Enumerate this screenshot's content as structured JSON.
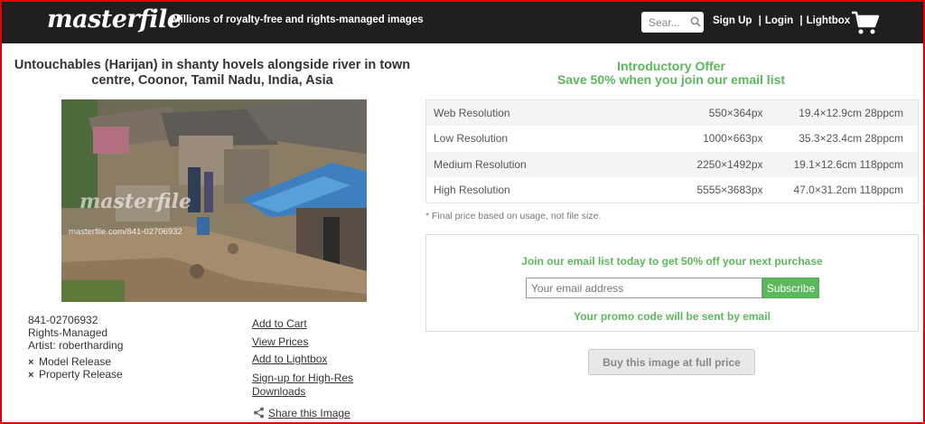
{
  "header": {
    "logo": "masterfile",
    "tagline": "Millions of royalty-free and rights-managed images",
    "search_placeholder": "Sear...",
    "nav": {
      "signup": "Sign Up",
      "login": "Login",
      "lightbox": "Lightbox",
      "separator": "|"
    }
  },
  "image": {
    "title": "Untouchables (Harijan) in shanty hovels alongside river in town centre, Coonor, Tamil Nadu, India, Asia",
    "watermark_logo": "masterfile",
    "watermark_url": "masterfile.com/841-02706932",
    "id": "841-02706932",
    "license": "Rights-Managed",
    "artist": "Artist: robertharding",
    "releases": [
      {
        "mark": "×",
        "label": "Model Release"
      },
      {
        "mark": "×",
        "label": "Property Release"
      }
    ]
  },
  "actions": {
    "add_to_cart": "Add to Cart",
    "view_prices": "View Prices",
    "add_to_lightbox": "Add to Lightbox",
    "signup_line1": "Sign-up for High-Res",
    "signup_line2": "Downloads",
    "share": "Share this Image"
  },
  "offer": {
    "line1": "Introductory Offer",
    "line2": "Save 50% when you join our email list"
  },
  "resolutions": [
    {
      "name": "Web Resolution",
      "pixels": "550×364px",
      "size": "19.4×12.9cm 28ppcm"
    },
    {
      "name": "Low Resolution",
      "pixels": "1000×663px",
      "size": "35.3×23.4cm 28ppcm"
    },
    {
      "name": "Medium Resolution",
      "pixels": "2250×1492px",
      "size": "19.1×12.6cm 118ppcm"
    },
    {
      "name": "High Resolution",
      "pixels": "5555×3683px",
      "size": "47.0×31.2cm 118ppcm"
    }
  ],
  "note": "* Final price based on usage, not file size.",
  "email": {
    "heading": "Join our email list today to get 50% off your next purchase",
    "placeholder": "Your email address",
    "button": "Subscribe",
    "promo": "Your promo code will be sent by email"
  },
  "buy_button": "Buy this image at full price",
  "colors": {
    "header_bg": "#1f1f1f",
    "accent_green": "#5cb85c",
    "frame_red": "#e00000"
  }
}
